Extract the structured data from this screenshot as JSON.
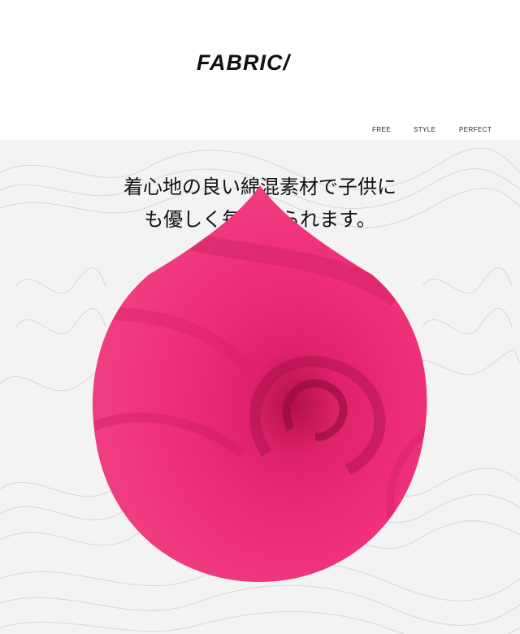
{
  "header": {
    "title": "FABRIC/",
    "tags": [
      "FREE",
      "STYLE",
      "PERFECT"
    ]
  },
  "copy": {
    "line1": "着心地の良い綿混素材で子供に",
    "line2": "も優しく毎日着られます。"
  },
  "colors": {
    "fabric": "#ee2d76",
    "background": "#f3f3f3"
  }
}
